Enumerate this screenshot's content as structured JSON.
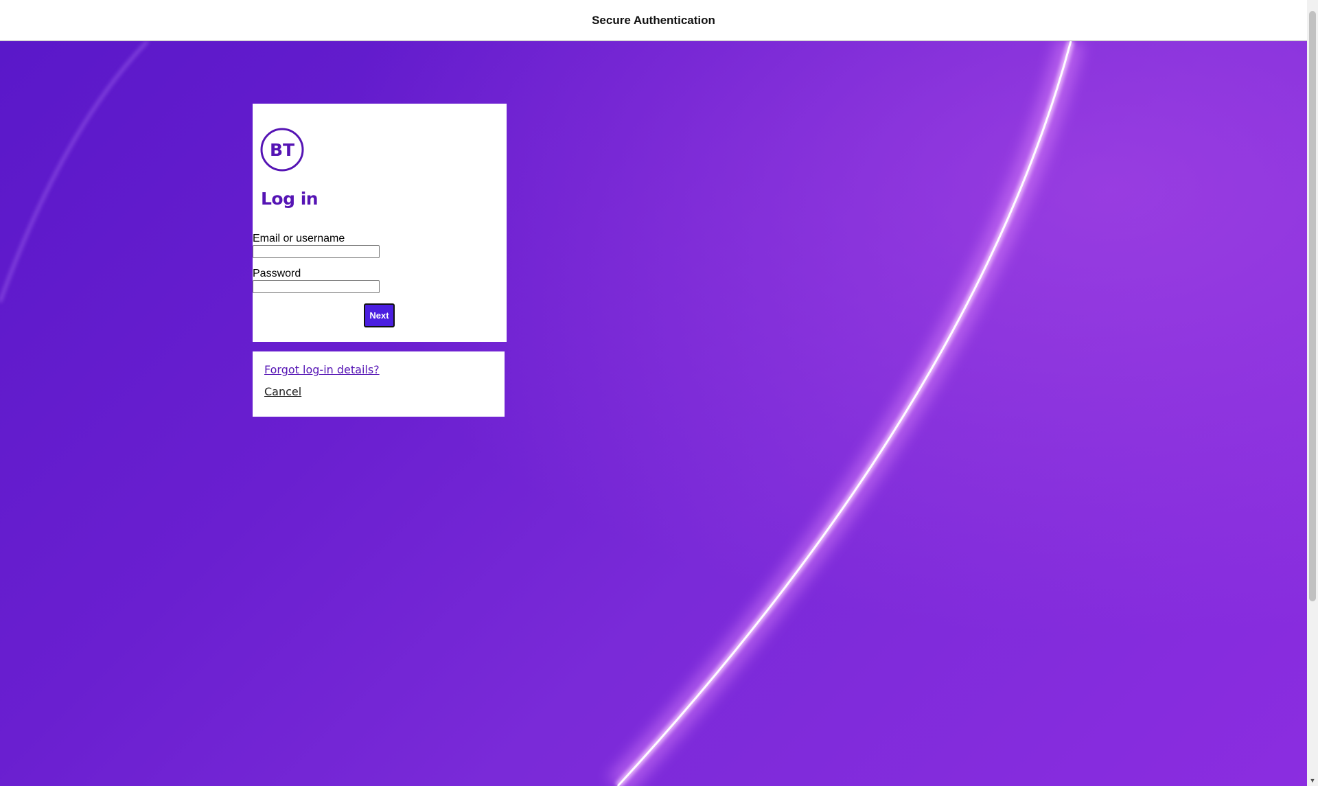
{
  "header": {
    "title": "Secure Authentication"
  },
  "login": {
    "logo_text": "BT",
    "heading": "Log in",
    "email_label": "Email or username",
    "email_value": "",
    "password_label": "Password",
    "password_value": "",
    "next_label": "Next"
  },
  "links": {
    "forgot": "Forgot log-in details?",
    "cancel": "Cancel"
  },
  "colors": {
    "brand_purple": "#5514b4",
    "button_blue": "#4b1fe0",
    "background": "#6a1fd0"
  },
  "icons": {
    "logo": "bt-logo-icon",
    "scroll_down": "chevron-down-icon"
  }
}
